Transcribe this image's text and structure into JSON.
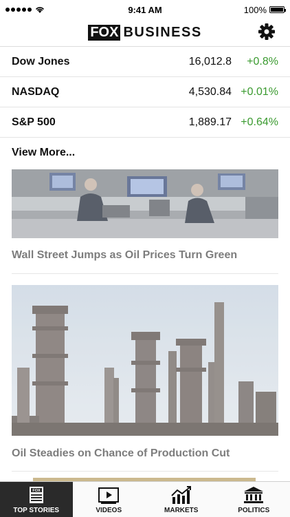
{
  "status_bar": {
    "time": "9:41 AM",
    "battery": "100%",
    "battery_level": 1.0
  },
  "header": {
    "logo_part1": "FOX",
    "logo_part2": "BUSINESS",
    "settings_icon": "gear-icon"
  },
  "tickers": [
    {
      "name": "Dow Jones",
      "value": "16,012.8",
      "change": "+0.8%"
    },
    {
      "name": "NASDAQ",
      "value": "4,530.84",
      "change": "+0.01%"
    },
    {
      "name": "S&P 500",
      "value": "1,889.17",
      "change": "+0.64%"
    }
  ],
  "view_more": "View More...",
  "stories": [
    {
      "title": "Wall Street Jumps as Oil Prices Turn Green",
      "image": "trading-floor-photo"
    },
    {
      "title": "Oil Steadies on Chance of Production Cut",
      "image": "oil-refinery-photo"
    }
  ],
  "tabs": [
    {
      "label": "TOP STORIES",
      "icon": "fox-news-icon",
      "active": true
    },
    {
      "label": "VIDEOS",
      "icon": "play-icon",
      "active": false
    },
    {
      "label": "MARKETS",
      "icon": "chart-icon",
      "active": false
    },
    {
      "label": "POLITICS",
      "icon": "capitol-icon",
      "active": false
    }
  ],
  "colors": {
    "positive": "#3a9a2f",
    "title_gray": "#7d7d7d",
    "active_tab": "#2a2a2a"
  }
}
